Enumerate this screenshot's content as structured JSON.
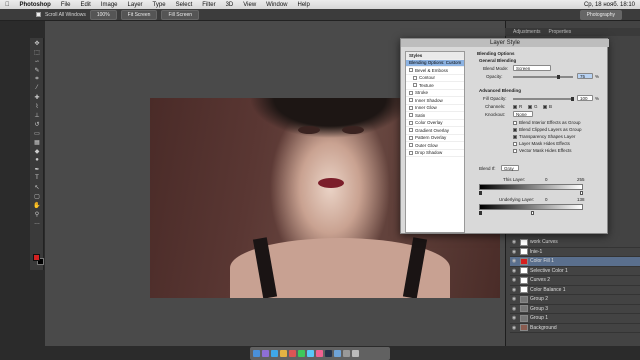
{
  "menubar": {
    "app": "Photoshop",
    "items": [
      "File",
      "Edit",
      "Image",
      "Layer",
      "Type",
      "Select",
      "Filter",
      "3D",
      "View",
      "Window",
      "Help"
    ],
    "clock": "Ср, 18 нояб. 18:10"
  },
  "optionsbar": {
    "scroll_all": "Scroll All Windows",
    "zoom": "100%",
    "fit_screen": "Fit Screen",
    "fill_screen": "Fill Screen",
    "workspace": "Photography"
  },
  "panels": {
    "tabs": [
      "Adjustments",
      "Properties"
    ]
  },
  "dialog": {
    "title": "Layer Style",
    "styles": [
      {
        "label": "Styles",
        "kind": "head"
      },
      {
        "label": "Blending Options: Custom",
        "kind": "sel"
      },
      {
        "label": "Bevel & Emboss",
        "kind": "item"
      },
      {
        "label": "Contour",
        "kind": "sub"
      },
      {
        "label": "Texture",
        "kind": "sub"
      },
      {
        "label": "Stroke",
        "kind": "item"
      },
      {
        "label": "Inner Shadow",
        "kind": "item"
      },
      {
        "label": "Inner Glow",
        "kind": "item"
      },
      {
        "label": "Satin",
        "kind": "item"
      },
      {
        "label": "Color Overlay",
        "kind": "item"
      },
      {
        "label": "Gradient Overlay",
        "kind": "item"
      },
      {
        "label": "Pattern Overlay",
        "kind": "item"
      },
      {
        "label": "Outer Glow",
        "kind": "item"
      },
      {
        "label": "Drop Shadow",
        "kind": "item"
      }
    ],
    "blending_options": "Blending Options",
    "general_blending": "General Blending",
    "blend_mode_label": "Blend Mode:",
    "blend_mode": "Screen",
    "opacity_label": "Opacity:",
    "opacity": "75",
    "pct": "%",
    "advanced_blending": "Advanced Blending",
    "fill_opacity_label": "Fill Opacity:",
    "fill_opacity": "100",
    "channels_label": "Channels:",
    "ch_r": "R",
    "ch_g": "G",
    "ch_b": "B",
    "knockout_label": "Knockout:",
    "knockout": "None",
    "checks": [
      {
        "label": "Blend Interior Effects as Group",
        "on": false
      },
      {
        "label": "Blend Clipped Layers as Group",
        "on": true
      },
      {
        "label": "Transparency Shapes Layer",
        "on": true
      },
      {
        "label": "Layer Mask Hides Effects",
        "on": false
      },
      {
        "label": "Vector Mask Hides Effects",
        "on": false
      }
    ],
    "blend_if_label": "Blend If:",
    "blend_if": "Gray",
    "this_layer_label": "This Layer:",
    "this_layer_min": "0",
    "this_layer_max": "255",
    "underlying_label": "Underlying Layer:",
    "underlying_min": "0",
    "underlying_max": "138"
  },
  "layers": [
    {
      "name": "work Curves",
      "thumb": "plain",
      "selected": false
    },
    {
      "name": "lnie-1",
      "thumb": "plain",
      "selected": false
    },
    {
      "name": "Color Fill 1",
      "thumb": "fill",
      "selected": true
    },
    {
      "name": "Selective Color 1",
      "thumb": "plain",
      "selected": false
    },
    {
      "name": "Curves 2",
      "thumb": "plain",
      "selected": false
    },
    {
      "name": "Color Balance 1",
      "thumb": "plain",
      "selected": false
    },
    {
      "name": "Group 2",
      "thumb": "folder",
      "selected": false
    },
    {
      "name": "Group 3",
      "thumb": "folder",
      "selected": false
    },
    {
      "name": "Group 1",
      "thumb": "folder",
      "selected": false
    },
    {
      "name": "Background",
      "thumb": "plain",
      "selected": false
    }
  ],
  "colors": {
    "foreground": "#d32222",
    "background": "#000000"
  }
}
